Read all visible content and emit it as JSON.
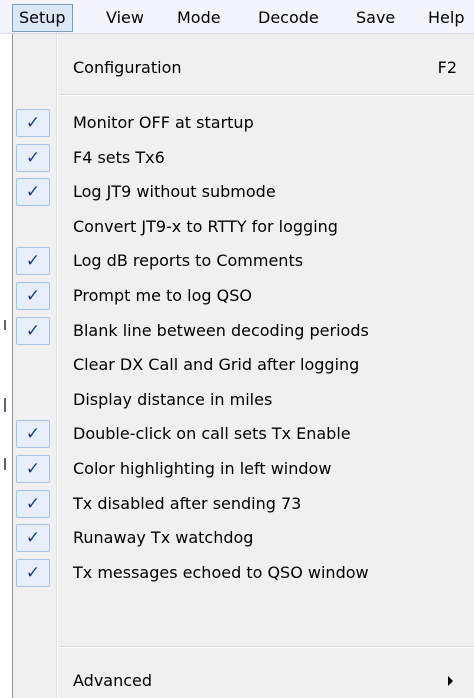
{
  "menubar": {
    "items": [
      {
        "label": "Setup",
        "active": true
      },
      {
        "label": "View"
      },
      {
        "label": "Mode"
      },
      {
        "label": "Decode"
      },
      {
        "label": "Save"
      },
      {
        "label": "Help"
      }
    ]
  },
  "dropdown": {
    "configuration": {
      "label": "Configuration",
      "shortcut": "F2"
    },
    "options": [
      {
        "label": "Monitor OFF at startup",
        "checked": true
      },
      {
        "label": "F4 sets Tx6",
        "checked": true
      },
      {
        "label": "Log JT9 without submode",
        "checked": true
      },
      {
        "label": "Convert JT9-x to RTTY for logging",
        "checked": false
      },
      {
        "label": "Log dB reports to Comments",
        "checked": true
      },
      {
        "label": "Prompt me to log QSO",
        "checked": true
      },
      {
        "label": "Blank line between decoding periods",
        "checked": true
      },
      {
        "label": "Clear DX Call and Grid after logging",
        "checked": false
      },
      {
        "label": "Display distance in miles",
        "checked": false
      },
      {
        "label": "Double-click on call sets Tx Enable",
        "checked": true
      },
      {
        "label": "Color highlighting in left window",
        "checked": true
      },
      {
        "label": "Tx disabled after sending 73",
        "checked": true
      },
      {
        "label": "Runaway Tx watchdog",
        "checked": true
      },
      {
        "label": "Tx messages echoed to QSO window",
        "checked": true
      }
    ],
    "advanced": {
      "label": "Advanced"
    },
    "check_glyph": "✓",
    "check_icon": "checkmark-icon",
    "submenu_icon": "submenu-arrow-icon"
  },
  "colors": {
    "menu_background": "#f0f0f0",
    "check_highlight": "#e6eefa",
    "check_border": "#a8c3ea",
    "active_menubar_item": "#dbe6f7"
  }
}
